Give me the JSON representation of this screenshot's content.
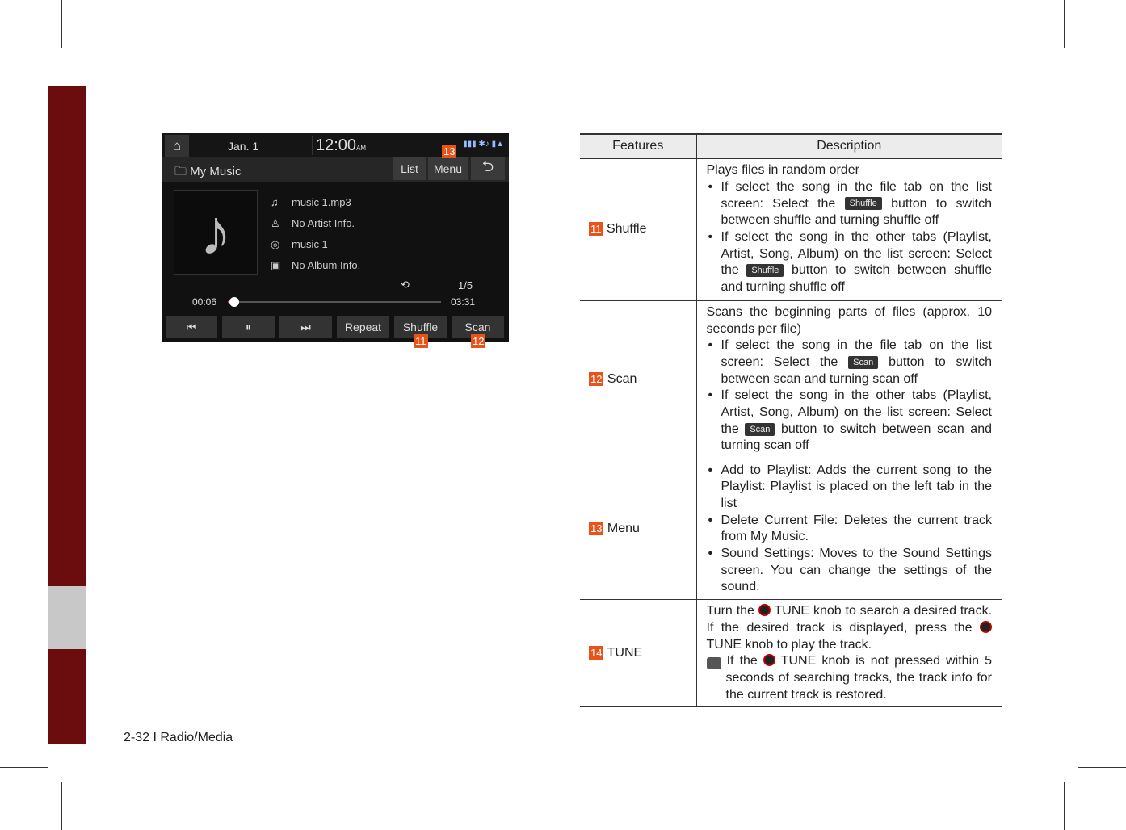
{
  "footer": "2-32 I Radio/Media",
  "screen": {
    "date": "Jan.  1",
    "time": "12:00",
    "ampm": "AM",
    "title": "My Music",
    "list": "List",
    "menu": "Menu",
    "track": "music 1.mp3",
    "artist": "No Artist Info.",
    "song": "music 1",
    "album": "No Album Info.",
    "count": "1/5",
    "elapsed": "00:06",
    "total": "03:31",
    "progress_percent": 3,
    "repeat": "Repeat",
    "shuffle": "Shuffle",
    "scan": "Scan"
  },
  "callouts": {
    "n11": "11",
    "n12": "12",
    "n13": "13",
    "n14": "14"
  },
  "table": {
    "headers": [
      "Features",
      "Description"
    ],
    "rows": [
      {
        "feature": "Shuffle",
        "intro": "Plays files in random order",
        "b1a": "If select the song in the file tab on the list screen: Select the",
        "b1btn": "Shuffle",
        "b1b": "button to switch between shuffle and turning shuffle off",
        "b2a": "If select the song in the other tabs (Playlist, Artist, Song, Album) on the list screen: Select the",
        "b2btn": "Shuffle",
        "b2b": "button to switch between shuffle and turning shuffle off"
      },
      {
        "feature": "Scan",
        "intro": "Scans the beginning parts of files (approx. 10 seconds per file)",
        "b1a": "If select the song in the file tab on the list screen: Select the",
        "b1btn": "Scan",
        "b1b": "button to switch between scan and turning scan off",
        "b2a": "If select the song in the other tabs (Playlist, Artist, Song, Album) on the list screen: Select the",
        "b2btn": "Scan",
        "b2b": "button to switch between scan and turning scan off"
      },
      {
        "feature": "Menu",
        "items": [
          "Add to Playlist: Adds the current song to the Playlist: Playlist is placed on the left tab in the list",
          "Delete Current File: Deletes the current track from My Music.",
          "Sound Settings: Moves to the Sound Settings screen. You can change the settings of the sound."
        ]
      },
      {
        "feature": "TUNE",
        "t1": "Turn the",
        "tune": "TUNE",
        "t2": "knob to search a desired track. If the desired track is displayed, press the",
        "t3": "knob to play the track.",
        "n1": "If the",
        "n2": "knob is not pressed within 5 seconds of searching tracks, the track info for the current track is restored."
      }
    ]
  }
}
